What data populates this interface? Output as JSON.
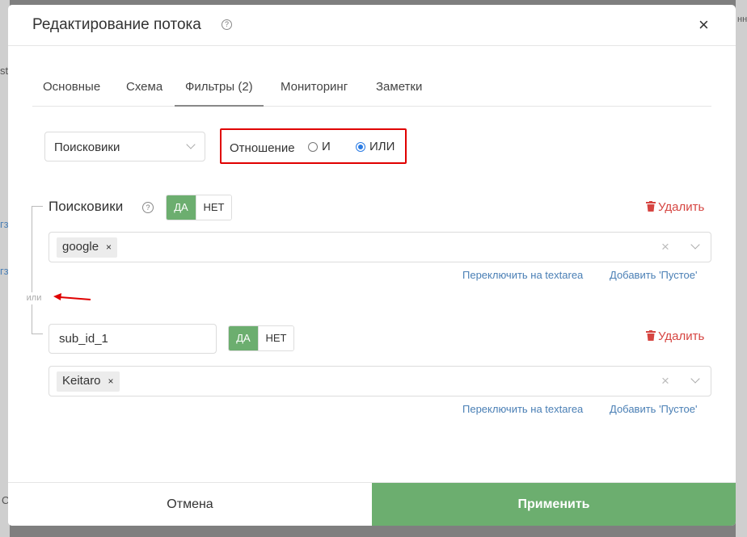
{
  "background": {
    "left_texts": [
      "stl",
      "гз",
      "гз",
      "C"
    ],
    "right_texts": [
      "нн"
    ]
  },
  "modal": {
    "title": "Редактирование потока",
    "help_icon": "question-circle-icon",
    "close_glyph": "×"
  },
  "tabs": [
    {
      "label": "Основные"
    },
    {
      "label": "Схема"
    },
    {
      "label": "Фильтры (2)"
    },
    {
      "label": "Мониторинг"
    },
    {
      "label": "Заметки"
    }
  ],
  "filter_select": {
    "value": "Поисковики"
  },
  "relation": {
    "label": "Отношение",
    "options": [
      {
        "label": "И",
        "checked": false
      },
      {
        "label": "ИЛИ",
        "checked": true
      }
    ]
  },
  "or_label": "или",
  "filters": [
    {
      "name": "Поисковики",
      "yes": "ДА",
      "no": "НЕТ",
      "delete": "Удалить",
      "tags": [
        "google"
      ],
      "switch_link": "Переключить на textarea",
      "empty_link": "Добавить 'Пустое'"
    },
    {
      "field_value": "sub_id_1",
      "yes": "ДА",
      "no": "НЕТ",
      "delete": "Удалить",
      "tags": [
        "Keitaro"
      ],
      "switch_link": "Переключить на textarea",
      "empty_link": "Добавить 'Пустое'"
    }
  ],
  "footer": {
    "cancel": "Отмена",
    "apply": "Применить"
  },
  "colors": {
    "accent_green": "#6cae6f",
    "delete_red": "#d64541",
    "link_blue": "#4a7fb5",
    "highlight_red": "#e00000"
  }
}
